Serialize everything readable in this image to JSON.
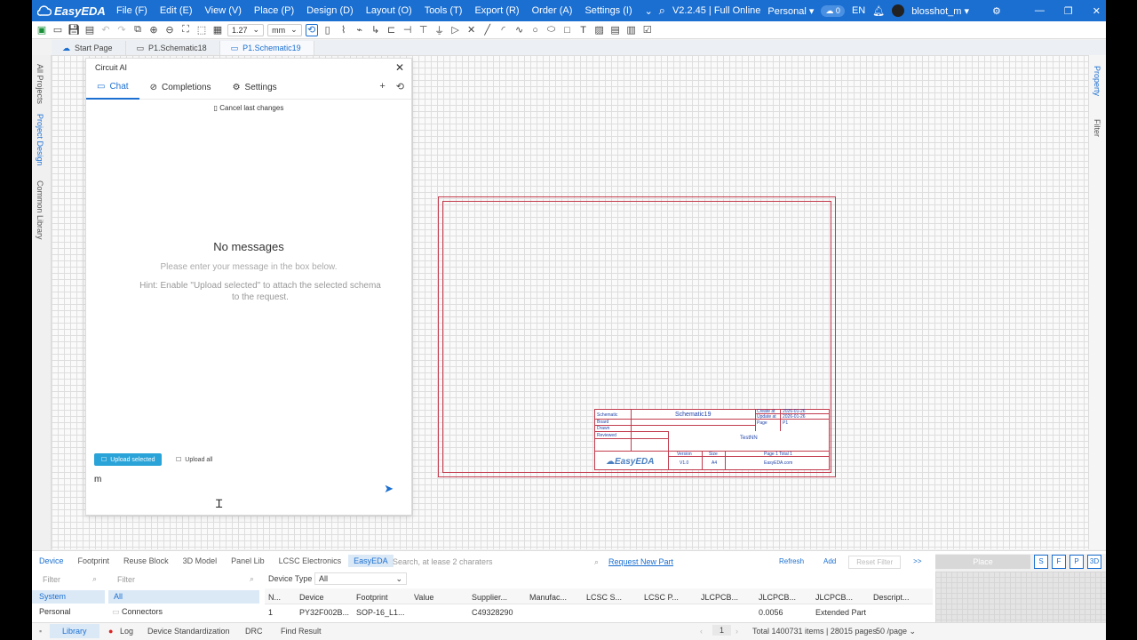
{
  "app": {
    "logo": "EasyEDA",
    "version": "V2.2.45 | Full Online",
    "mode": "Personal",
    "cloud_count": "0",
    "lang": "EN",
    "user": "blosshot_m"
  },
  "menu": [
    "File (F)",
    "Edit (E)",
    "View (V)",
    "Place (P)",
    "Design (D)",
    "Layout (O)",
    "Tools (T)",
    "Export (R)",
    "Order (A)",
    "Settings (I)"
  ],
  "toolbar": {
    "grid_value": "1.27",
    "unit": "mm"
  },
  "tabs": [
    {
      "label": "Start Page",
      "active": false
    },
    {
      "label": "P1.Schematic18",
      "active": false
    },
    {
      "label": "P1.Schematic19",
      "active": true
    }
  ],
  "left_rail": [
    "All Projects",
    "Project Design",
    "Common Library"
  ],
  "right_rail": [
    "Property",
    "Filter"
  ],
  "ai_panel": {
    "title": "Circuit AI",
    "tabs": [
      "Chat",
      "Completions",
      "Settings"
    ],
    "cancel_label": "Cancel last changes",
    "empty_title": "No messages",
    "empty_hint": "Please enter your message in the box below.",
    "upload_hint": "Hint: Enable \"Upload selected\" to attach the selected schema to the request.",
    "upload_selected": "Upload selected",
    "upload_all": "Upload all",
    "input_value": "m"
  },
  "title_block": {
    "schematic_label": "Schematic",
    "schematic_name": "Schematic19",
    "create_label": "Create at",
    "create_date": "2026-01-26",
    "update_label": "Update at",
    "update_date": "2026-01-26",
    "board_label": "Board",
    "page_label": "Page",
    "page_value": "P1",
    "drawn_label": "Drawn",
    "reviewed_label": "Reviewed",
    "project_name": "TestNN",
    "version_label": "Version",
    "size_label": "Size",
    "page_total": "Page 1 Total 1",
    "version_value": "V1.0",
    "size_value": "A4",
    "site": "EasyEDA.com",
    "logo": "EasyEDA"
  },
  "bottom_panel": {
    "tabs": [
      "Device",
      "Footprint",
      "Reuse Block",
      "3D Model",
      "Panel Lib",
      "LCSC Electronics",
      "EasyEDA"
    ],
    "search_placeholder": "Search, at lease 2 charaters",
    "request_link": "Request New Part",
    "actions": [
      "Refresh",
      "Add",
      "Reset Filter"
    ],
    "more": ">>",
    "place_button": "Place",
    "view_buttons": [
      "S",
      "F",
      "P",
      "3D"
    ],
    "filter_placeholder": "Filter",
    "filter_placeholder2": "Filter",
    "device_type_label": "Device Type",
    "device_type_value": "All",
    "library_rows": [
      "System",
      "Personal"
    ],
    "category_rows": [
      "All",
      "Connectors"
    ],
    "columns": [
      "N...",
      "Device",
      "Footprint",
      "Value",
      "Supplier...",
      "Manufac...",
      "LCSC S...",
      "LCSC P...",
      "JLCPCB...",
      "JLCPCB...",
      "JLCPCB...",
      "Descript..."
    ],
    "row": {
      "n": "1",
      "device": "PY32F002B...",
      "footprint": "SOP-16_L1...",
      "value": "",
      "supplier": "C49328290",
      "price": "0.0056",
      "type": "Extended Part"
    }
  },
  "statusbar": {
    "items": [
      "Library",
      "Log",
      "Device Standardization",
      "DRC",
      "Find Result"
    ],
    "page": "1",
    "total": "Total 1400731 items | 28015 pages",
    "per_page": "50 /page"
  }
}
